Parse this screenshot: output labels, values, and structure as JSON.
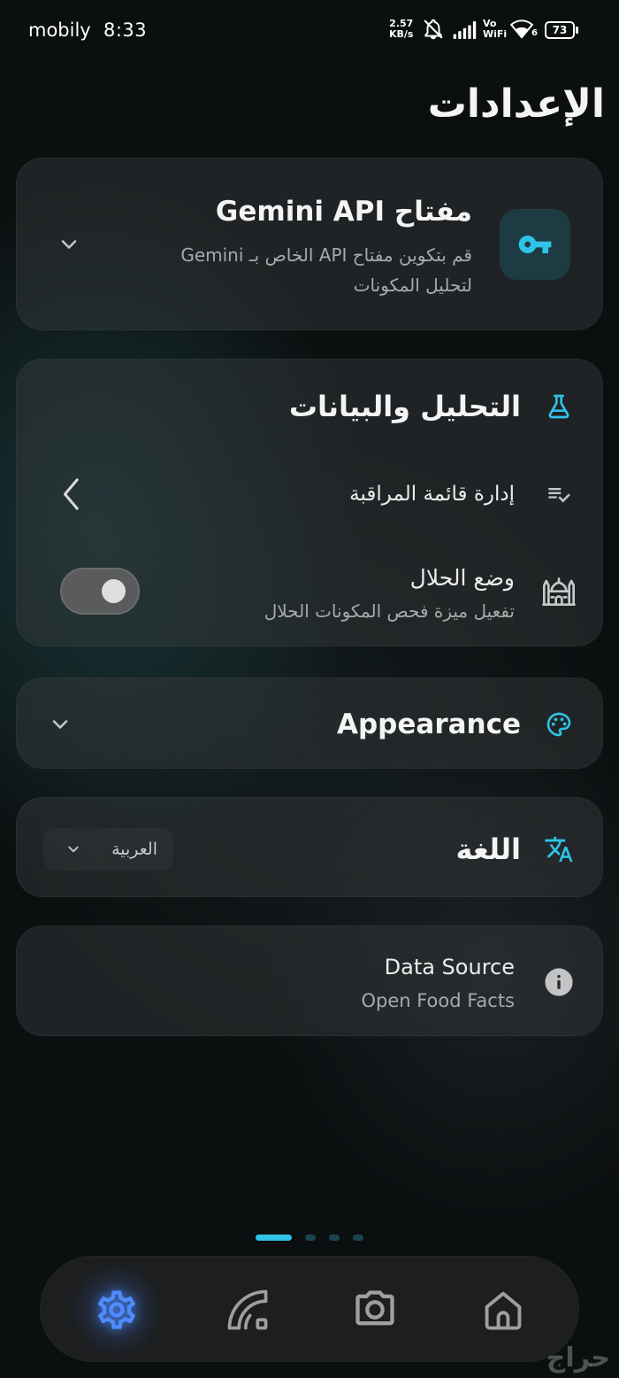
{
  "status_bar": {
    "carrier": "mobily",
    "time": "8:33",
    "net_speed": "2.57",
    "net_speed_unit": "KB/s",
    "volte_line1": "Vo",
    "volte_line2": "WiFi",
    "wifi_badge": "6",
    "battery_level": "73",
    "icons": [
      "mute-icon",
      "signal-icon",
      "wifi-icon",
      "battery-icon"
    ]
  },
  "header": {
    "title": "الإعدادات"
  },
  "gemini_api": {
    "title": "مفتاح Gemini API",
    "description": [
      "قم بتكوين مفتاح API الخاص بـ Gemini",
      "لتحليل المكونات"
    ],
    "icon": "key-icon",
    "expanded": false
  },
  "analysis": {
    "title": "التحليل والبيانات",
    "icon": "flask-icon",
    "watchlist": {
      "label": "إدارة قائمة المراقبة",
      "icon": "list-check-icon"
    },
    "halal_mode": {
      "label": "وضع الحلال",
      "description": "تفعيل ميزة فحص المكونات الحلال",
      "icon": "mosque-icon",
      "enabled": false
    }
  },
  "appearance": {
    "title": "Appearance",
    "icon": "palette-icon",
    "expanded": false
  },
  "language": {
    "title": "اللغة",
    "icon": "translate-icon",
    "selected": "العربية"
  },
  "data_source": {
    "title": "Data Source",
    "value": "Open Food Facts",
    "icon": "info-icon"
  },
  "pager": {
    "pages": 4,
    "active_page": 4
  },
  "bottom_nav": {
    "items": [
      {
        "icon": "home-icon",
        "active": false
      },
      {
        "icon": "camera-icon",
        "active": false
      },
      {
        "icon": "gauge-icon",
        "active": false
      },
      {
        "icon": "settings-icon",
        "active": true
      }
    ]
  },
  "colors": {
    "accent": "#2ec3e7",
    "icon_box": "#1d3b43",
    "nav_active": "#4e8cff",
    "muted_text": "#a7a9ab",
    "pager_inactive": "#1a4450"
  },
  "watermark": "حراج"
}
